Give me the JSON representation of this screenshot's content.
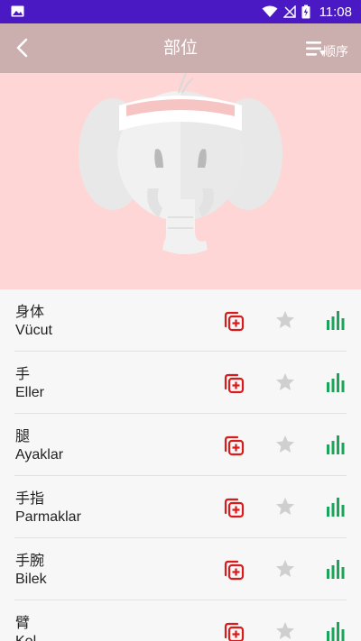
{
  "status_bar": {
    "time": "11:08",
    "icons": [
      "image-icon",
      "wifi-icon",
      "signal-icon",
      "battery-charging-icon"
    ]
  },
  "app_bar": {
    "title": "部位",
    "back_icon": "chevron-left-icon",
    "sort_icon": "sort-list-icon",
    "sort_label": "顺序"
  },
  "hero": {
    "illustration": "elephant-with-headband"
  },
  "colors": {
    "status_bar": "#4a19c4",
    "app_bar": "#cbaeae",
    "hero_background": "#ffd6d6",
    "add_icon": "#d81b1b",
    "star_icon": "#cfcfcf",
    "stats_icon": "#1aa65a"
  },
  "list": {
    "items": [
      {
        "chinese": "身体",
        "turkish": "Vücut"
      },
      {
        "chinese": "手",
        "turkish": "Eller"
      },
      {
        "chinese": "腿",
        "turkish": "Ayaklar"
      },
      {
        "chinese": "手指",
        "turkish": "Parmaklar"
      },
      {
        "chinese": "手腕",
        "turkish": "Bilek"
      },
      {
        "chinese": "臂",
        "turkish": "Kol"
      }
    ],
    "row_icons": [
      "add-to-list-icon",
      "star-icon",
      "stats-bars-icon"
    ]
  }
}
